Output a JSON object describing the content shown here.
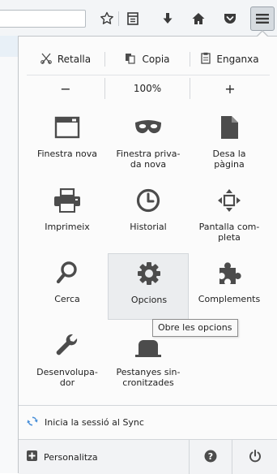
{
  "toolbar": {
    "icons": [
      "bookmark-star-icon",
      "reading-list-icon",
      "download-icon",
      "home-icon",
      "pocket-icon",
      "hamburger-menu-icon"
    ]
  },
  "edit_row": {
    "cut_label": "Retalla",
    "copy_label": "Copia",
    "paste_label": "Enganxa"
  },
  "zoom": {
    "minus": "−",
    "value": "100%",
    "plus": "+"
  },
  "grid": [
    {
      "label": "Finestra nova",
      "icon": "new-window-icon"
    },
    {
      "label": "Finestra priva-\nda nova",
      "icon": "private-mask-icon"
    },
    {
      "label": "Desa la\npàgina",
      "icon": "save-page-icon"
    },
    {
      "label": "Imprimeix",
      "icon": "printer-icon"
    },
    {
      "label": "Historial",
      "icon": "history-clock-icon"
    },
    {
      "label": "Pantalla com-\npleta",
      "icon": "fullscreen-icon"
    },
    {
      "label": "Cerca",
      "icon": "search-icon"
    },
    {
      "label": "Opcions",
      "icon": "gear-icon"
    },
    {
      "label": "Complements",
      "icon": "puzzle-icon"
    },
    {
      "label": "Desenvolupa-\ndor",
      "icon": "wrench-icon"
    },
    {
      "label": "Pestanyes sin-\ncronitzades",
      "icon": "synced-tabs-icon"
    }
  ],
  "tooltip": "Obre les opcions",
  "sync": {
    "label": "Inicia la sessió al Sync"
  },
  "footer": {
    "customize_label": "Personalitza"
  },
  "colors": {
    "accent": "#4a90d9",
    "icon": "#4c4c4c",
    "panel_bg": "#fbfbfb"
  }
}
